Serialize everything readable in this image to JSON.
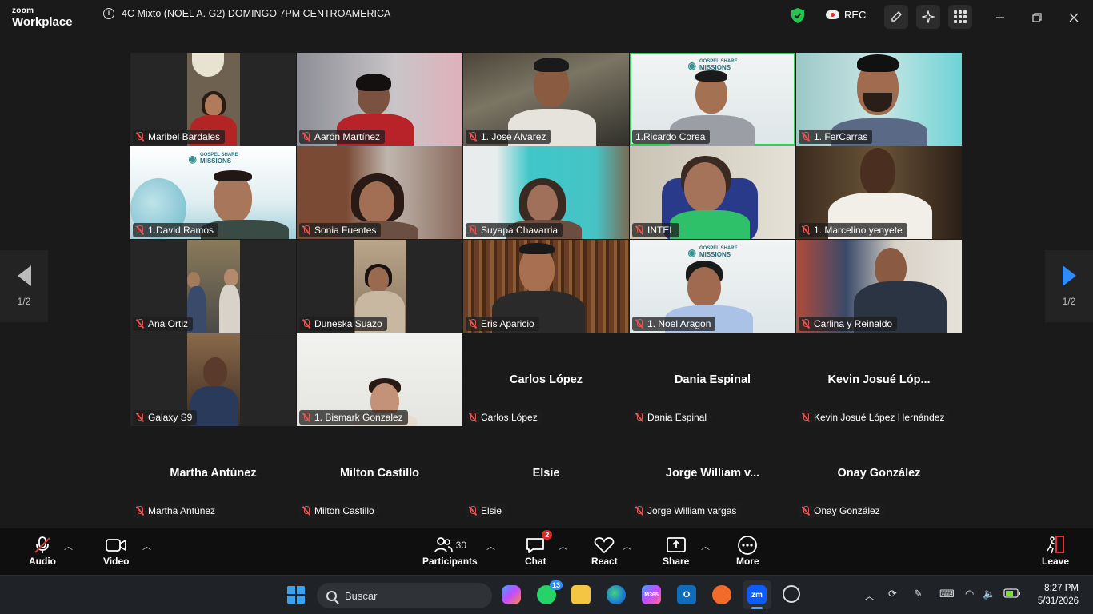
{
  "app": {
    "brand_top": "zoom",
    "brand_bottom": "Workplace",
    "meeting_title": "4C Mixto (NOEL A. G2) DOMINGO 7PM CENTROAMERICA"
  },
  "titlebar": {
    "rec_label": "REC"
  },
  "gallery": {
    "page_indicator_left": "1/2",
    "page_indicator_right": "1/2",
    "video_tiles": [
      {
        "name": "Maribel Bardales"
      },
      {
        "name": "Aarón Martínez"
      },
      {
        "name": "1. Jose Alvarez"
      },
      {
        "name": "1.Ricardo Corea",
        "active": true
      },
      {
        "name": "1. FerCarras"
      },
      {
        "name": "1.David Ramos"
      },
      {
        "name": "Sonia Fuentes"
      },
      {
        "name": "Suyapa Chavarria"
      },
      {
        "name": "INTEL"
      },
      {
        "name": "1. Marcelino yenyete"
      },
      {
        "name": "Ana Ortiz"
      },
      {
        "name": "Duneska Suazo"
      },
      {
        "name": "Eris Aparicio"
      },
      {
        "name": "1. Noel Aragon"
      },
      {
        "name": "Carlina y Reinaldo"
      },
      {
        "name": "Galaxy S9"
      },
      {
        "name": "1. Bismark Gonzalez"
      }
    ],
    "name_tiles": [
      {
        "display": "Carlos López",
        "tag": "Carlos López"
      },
      {
        "display": "Dania Espinal",
        "tag": "Dania Espinal"
      },
      {
        "display": "Kevin Josué Lóp...",
        "tag": "Kevin Josué López Hernández"
      },
      {
        "display": "Martha Antúnez",
        "tag": "Martha Antúnez"
      },
      {
        "display": "Milton Castillo",
        "tag": "Milton Castillo"
      },
      {
        "display": "Elsie",
        "tag": "Elsie"
      },
      {
        "display": "Jorge William v...",
        "tag": "Jorge William vargas"
      },
      {
        "display": "Onay González",
        "tag": "Onay González"
      }
    ],
    "gsm_logo": {
      "line1": "GOSPEL SHARE",
      "line2": "MISSIONS"
    }
  },
  "controls": {
    "audio": "Audio",
    "video": "Video",
    "participants": "Participants",
    "participants_count": "30",
    "chat": "Chat",
    "chat_badge": "2",
    "react": "React",
    "share": "Share",
    "more": "More",
    "leave": "Leave"
  },
  "taskbar": {
    "search_placeholder": "Buscar",
    "whatsapp_badge": "13",
    "time": "8:27 PM",
    "date": "5/31/2026"
  }
}
